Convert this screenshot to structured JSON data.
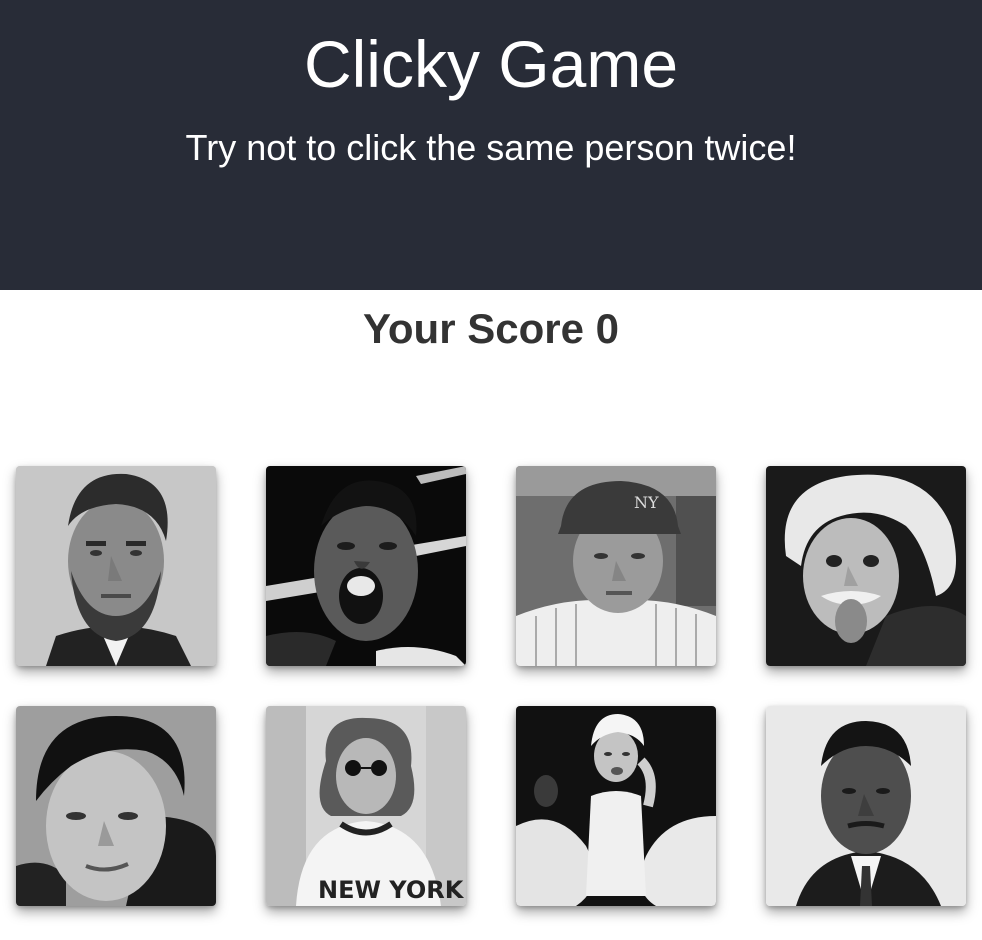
{
  "header": {
    "title": "Clicky Game",
    "subtitle": "Try not to click the same person twice!"
  },
  "score": {
    "text": "Your Score 0"
  },
  "cards": [
    {
      "name": "lincoln-card"
    },
    {
      "name": "ali-card"
    },
    {
      "name": "ruth-card"
    },
    {
      "name": "einstein-card"
    },
    {
      "name": "elvis-card"
    },
    {
      "name": "lennon-card",
      "shirt_text": "NEW YORK"
    },
    {
      "name": "monroe-card"
    },
    {
      "name": "king-card"
    }
  ],
  "colors": {
    "header_bg": "#282c37",
    "header_text": "#ffffff",
    "score_text": "#333333"
  }
}
